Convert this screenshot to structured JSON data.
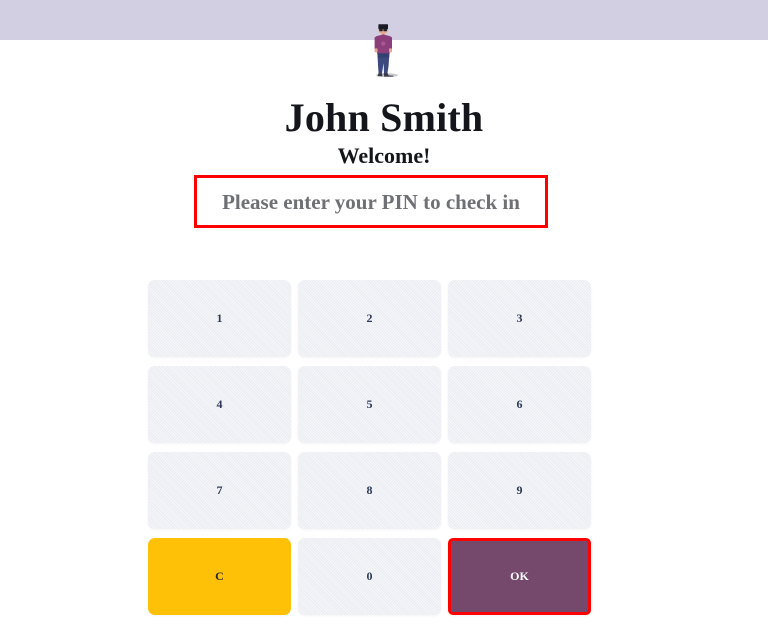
{
  "theme": {
    "topbar_color": "#d2cfe2",
    "page_background": "#ffffff",
    "key_background": "#e9ecf1",
    "key_text_color": "#2e3a55",
    "clear_key_color": "#ffc107",
    "ok_key_color": "#75496b",
    "highlight_border_color": "#ff0000",
    "prompt_text_color": "#6f7075",
    "heading_color": "#14161c"
  },
  "header": {
    "avatar_icon": "standing-person-avatar-icon"
  },
  "user": {
    "name": "John Smith",
    "greeting": "Welcome!"
  },
  "prompt": {
    "message": "Please enter your PIN to check in"
  },
  "keypad": {
    "keys": [
      {
        "label": "1",
        "role": "digit"
      },
      {
        "label": "2",
        "role": "digit"
      },
      {
        "label": "3",
        "role": "digit"
      },
      {
        "label": "4",
        "role": "digit"
      },
      {
        "label": "5",
        "role": "digit"
      },
      {
        "label": "6",
        "role": "digit"
      },
      {
        "label": "7",
        "role": "digit"
      },
      {
        "label": "8",
        "role": "digit"
      },
      {
        "label": "9",
        "role": "digit"
      },
      {
        "label": "C",
        "role": "clear"
      },
      {
        "label": "0",
        "role": "digit"
      },
      {
        "label": "OK",
        "role": "confirm"
      }
    ]
  }
}
